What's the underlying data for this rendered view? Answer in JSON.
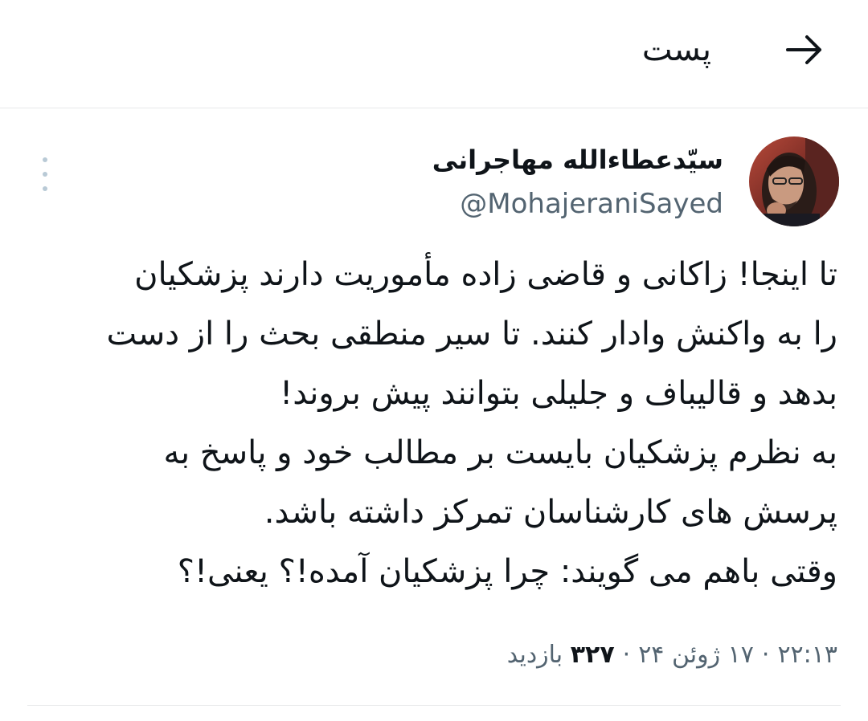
{
  "header": {
    "title": "پست",
    "back_icon": "arrow-right-icon"
  },
  "author": {
    "name": "سیّدعطاءالله مهاجرانی",
    "handle": "@MohajeraniSayed",
    "avatar_icon": "avatar-photo"
  },
  "tweet": {
    "text": "تا اینجا! زاکانی و قاضی زاده مأموریت دارند پزشکیان\nرا به واکنش وادار کنند. تا سیر منطقی بحث را از دست\nبدهد و قالیباف و جلیلی بتوانند پیش بروند!\nبه نظرم پزشکیان بایست بر مطالب خود و پاسخ به\nپرسش های کارشناسان تمرکز داشته باشد.\nوقتی  باهم می گویند: چرا پزشکیان آمده!؟ یعنی!؟"
  },
  "meta": {
    "time": "۲۲:۱۳",
    "date": "۱۷ ژوئن ۲۴",
    "separator": "·",
    "views_count": "۳۲۷",
    "views_label": "بازدید"
  },
  "colors": {
    "text": "#0f1419",
    "secondary": "#536471",
    "divider": "#e7e9ea"
  }
}
